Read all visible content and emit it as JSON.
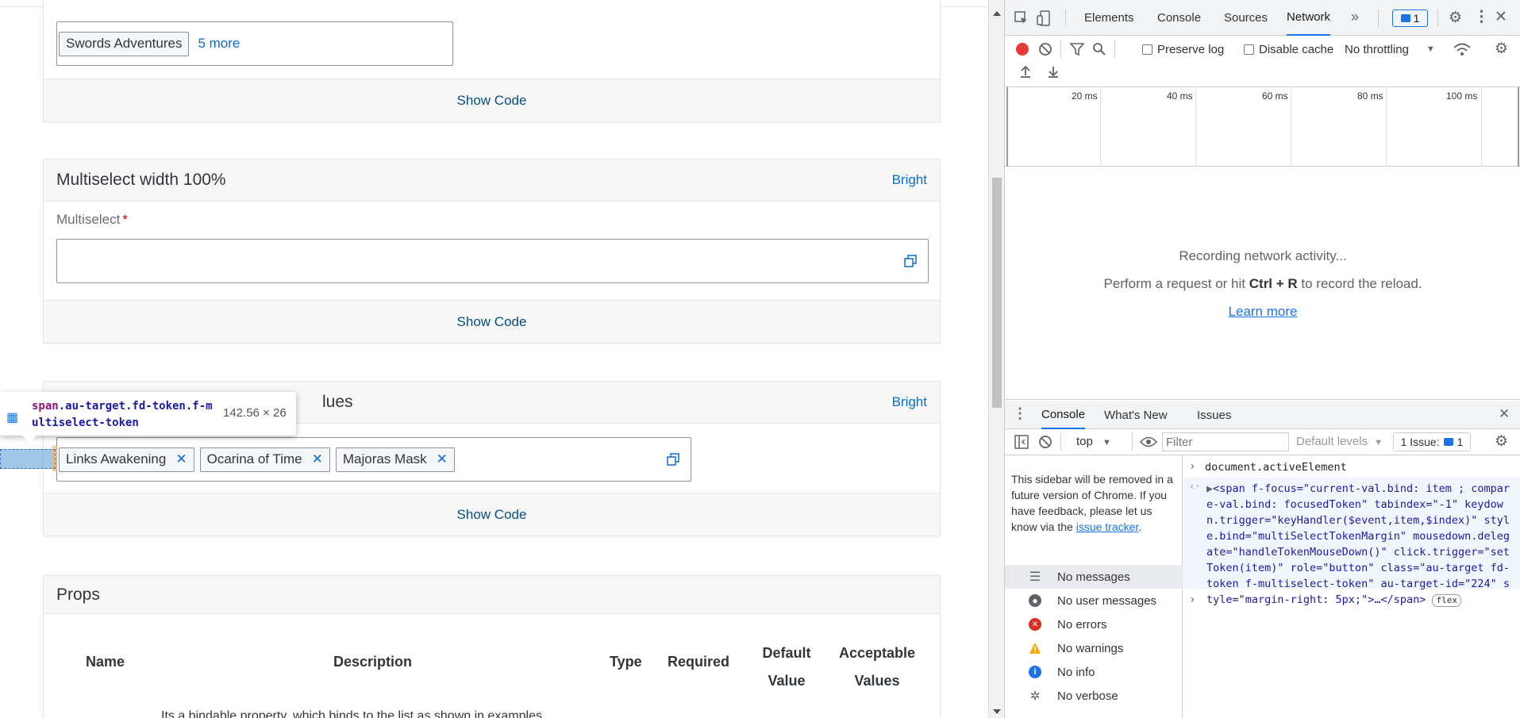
{
  "page": {
    "example1": {
      "token": "Swords Adventures",
      "more": "5 more",
      "show_code": "Show Code"
    },
    "example2": {
      "title": "Multiselect width 100%",
      "bright": "Bright",
      "label": "Multiselect",
      "required_mark": "*",
      "show_code": "Show Code"
    },
    "example3": {
      "title_visible": "lues",
      "bright": "Bright",
      "tokens": [
        "Links Awakening",
        "Ocarina of Time",
        "Majoras Mask"
      ],
      "token_close": "✕",
      "show_code": "Show Code"
    },
    "props": {
      "title": "Props",
      "headers": {
        "name": "Name",
        "description": "Description",
        "type": "Type",
        "required": "Required",
        "default_value_1": "Default",
        "default_value_2": "Value",
        "acceptable_values_1": "Acceptable",
        "acceptable_values_2": "Values"
      },
      "row_desc": "Its a bindable property, which binds to the list as shown in examples"
    }
  },
  "inspector_tooltip": {
    "tag": "span",
    "selector": ".au-target.fd-token.f-multiselect-token",
    "size": "142.56 × 26"
  },
  "devtools": {
    "tabs": [
      "Elements",
      "Console",
      "Sources",
      "Network"
    ],
    "active_tab": "Network",
    "issues_count": "1",
    "toolbar": {
      "preserve_log": "Preserve log",
      "disable_cache": "Disable cache",
      "throttling": "No throttling"
    },
    "timeline_ticks": [
      "20 ms",
      "40 ms",
      "60 ms",
      "80 ms",
      "100 ms"
    ],
    "network_empty": {
      "line1": "Recording network activity...",
      "line2_pre": "Perform a request or hit ",
      "line2_key": "Ctrl + R",
      "line2_post": " to record the reload.",
      "learn_more": "Learn more"
    },
    "drawer": {
      "tabs": [
        "Console",
        "What's New",
        "Issues"
      ],
      "active": "Console"
    },
    "console_toolbar": {
      "context": "top",
      "filter_placeholder": "Filter",
      "levels": "Default levels",
      "issues": "1 Issue:",
      "issues_count": "1"
    },
    "sidebar": {
      "note_pre": "This sidebar will be removed in a future version of Chrome. If you have feedback, please let us know via the ",
      "note_link": "issue tracker",
      "note_post": ".",
      "items": [
        "No messages",
        "No user messages",
        "No errors",
        "No warnings",
        "No info",
        "No verbose"
      ]
    },
    "console": {
      "command": "document.activeElement",
      "result_html_text": "<span f-focus=\"current-val.bind: item ; compare-val.bind: focusedToken\" tabindex=\"-1\" keydown.trigger=\"keyHandler($event,item,$index)\" style.bind=\"multiSelectTokenMargin\" mousedown.delegate=\"handleTokenMouseDown()\" click.trigger=\"setToken(item)\" role=\"button\" class=\"au-target fd-token f-multiselect-token\" au-target-id=\"224\" style=\"margin-right: 5px;\">…</span>",
      "flex_chip": "flex"
    }
  }
}
